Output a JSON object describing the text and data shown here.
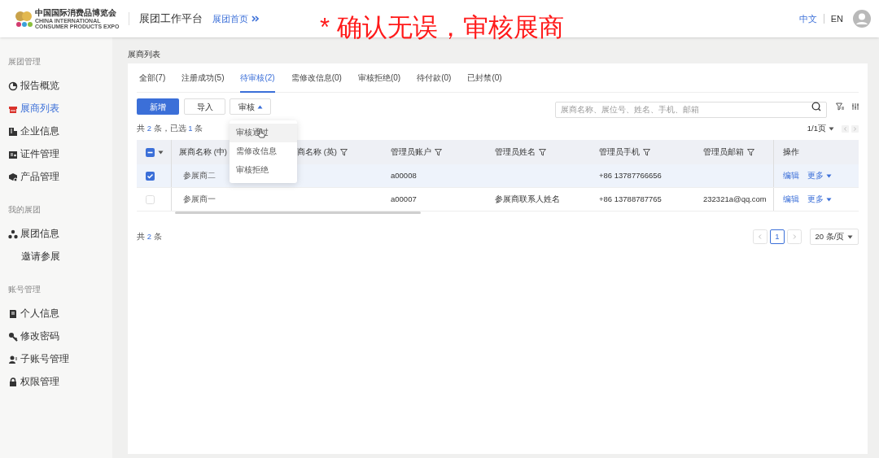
{
  "header": {
    "logo": {
      "name_zh": "中国国际消费品博览会",
      "name_en_1": "CHINA INTERNATIONAL",
      "name_en_2": "CONSUMER PRODUCTS EXPO"
    },
    "platform_title": "展团工作平台",
    "home_link": "展团首页",
    "languages": [
      {
        "label": "中文",
        "selected": true
      },
      {
        "label": "EN",
        "selected": false
      }
    ]
  },
  "caption": "* 确认无误，审核展商",
  "sidebar": {
    "groups": [
      {
        "title": "展团管理",
        "items": [
          {
            "label": "报告概览",
            "selected": false
          },
          {
            "label": "展商列表",
            "selected": true
          },
          {
            "label": "企业信息",
            "selected": false
          },
          {
            "label": "证件管理",
            "selected": false
          },
          {
            "label": "产品管理",
            "selected": false
          }
        ]
      },
      {
        "title": "我的展团",
        "items": [
          {
            "label": "展团信息",
            "selected": false,
            "children": [
              {
                "label": "邀请参展",
                "selected": false
              }
            ]
          }
        ]
      },
      {
        "title": "账号管理",
        "items": [
          {
            "label": "个人信息",
            "selected": false
          },
          {
            "label": "修改密码",
            "selected": false
          },
          {
            "label": "子账号管理",
            "selected": false
          },
          {
            "label": "权限管理",
            "selected": false
          }
        ]
      }
    ]
  },
  "breadcrumb": "展商列表",
  "tabs": [
    {
      "label": "全部(7)",
      "selected": false
    },
    {
      "label": "注册成功(5)",
      "selected": false
    },
    {
      "label": "待审核(2)",
      "selected": true
    },
    {
      "label": "需修改信息(0)",
      "selected": false
    },
    {
      "label": "审核拒绝(0)",
      "selected": false
    },
    {
      "label": "待付款(0)",
      "selected": false
    },
    {
      "label": "已封禁(0)",
      "selected": false
    }
  ],
  "toolbar": {
    "add_button": "新增",
    "import_button": "导入",
    "audit_button": {
      "label": "审核",
      "expanded": true
    },
    "search": {
      "placeholder": "展商名称、展位号、姓名、手机、邮箱"
    }
  },
  "audit_menu": [
    {
      "label": "审核通过",
      "hovered": true
    },
    {
      "label": "需修改信息",
      "hovered": false
    },
    {
      "label": "审核拒绝",
      "hovered": false
    }
  ],
  "summary": {
    "prefix": "共",
    "total": "2",
    "middle": "条，已选",
    "selected": "1",
    "suffix": "条"
  },
  "page_info": "1/1页",
  "table": {
    "select_all_indeterminate": true,
    "columns": [
      {
        "label": "展商名称 (中)",
        "filterable": false
      },
      {
        "label": "商名称 (英)",
        "filterable": true
      },
      {
        "label": "管理员账户",
        "filterable": true
      },
      {
        "label": "管理员姓名",
        "filterable": true
      },
      {
        "label": "管理员手机",
        "filterable": true
      },
      {
        "label": "管理员邮箱",
        "filterable": true
      },
      {
        "label": "操作",
        "filterable": false
      }
    ],
    "rows": [
      {
        "selected": true,
        "cells": [
          "参展商二",
          "",
          "a00008",
          "",
          "+86 13787766656",
          ""
        ],
        "actions": [
          "编辑",
          "更多"
        ]
      },
      {
        "selected": false,
        "cells": [
          "参展商一",
          "",
          "a00007",
          "参展商联系人姓名",
          "+86 13788787765",
          "232321a@qq.com"
        ],
        "actions": [
          "编辑",
          "更多"
        ]
      }
    ]
  },
  "footer": {
    "total_prefix": "共",
    "total": "2",
    "total_suffix": "条",
    "pages": [
      {
        "label": "1",
        "selected": true
      }
    ],
    "page_size": "20 条/页"
  }
}
